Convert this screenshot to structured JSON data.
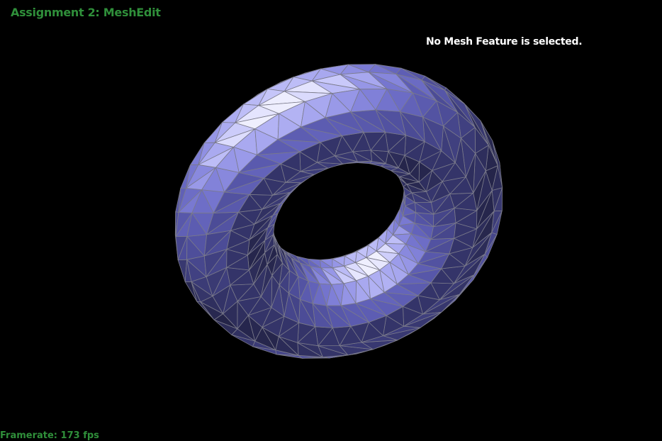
{
  "app": {
    "title": "Assignment 2: MeshEdit",
    "title_color": "#2f8f3a"
  },
  "status": {
    "selection_text": "No Mesh Feature is selected."
  },
  "footer": {
    "framerate_text": "Framerate: 173 fps"
  },
  "scene": {
    "object": "torus-mesh",
    "base_color": "#8080ff",
    "edge_color": "#7a7a8a",
    "background": "#000000"
  }
}
